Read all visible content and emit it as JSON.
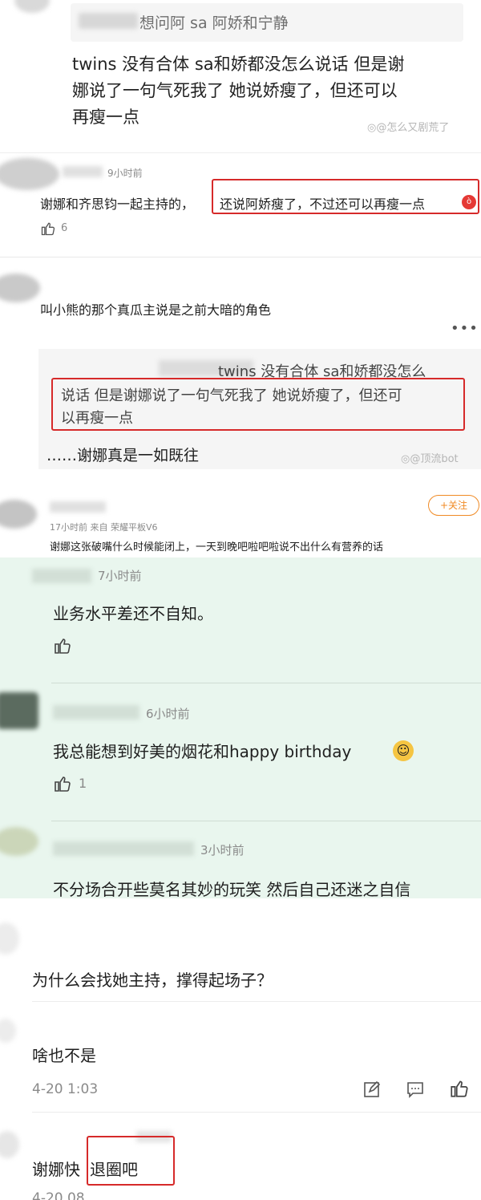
{
  "s1": {
    "quote": "想问阿 sa 阿娇和宁静",
    "body_lines": [
      "twins 没有合体 sa和娇都没怎么说话 但是谢",
      "娜说了一句气死我了 她说娇瘦了，但还可以",
      "再瘦一点"
    ],
    "watermark": "@怎么又剧荒了"
  },
  "s2": {
    "time": "9小时前",
    "text_a": "谢娜和齐思钧一起主持的，",
    "text_b": "还说阿娇瘦了，不过还可以再瘦一点",
    "likes": "6"
  },
  "s3": {
    "text": "叫小熊的那个真瓜主说是之前大暗的角色",
    "quote_lines": [
      "twins 没有合体 sa和娇都没怎么",
      "说话 但是谢娜说了一句气死我了 她说娇瘦了，但还可",
      "以再瘦一点"
    ],
    "reply": "……谢娜真是一如既往",
    "watermark": "@顶流bot"
  },
  "s4": {
    "follow": "+关注",
    "meta": "17小时前  来自 荣耀平板V6",
    "text": "谢娜这张破嘴什么时候能闭上，一天到晚吧啦吧啦说不出什么有营养的话"
  },
  "s5": {
    "c1": {
      "time": "7小时前",
      "text": "业务水平差还不自知。"
    },
    "c2": {
      "time": "6小时前",
      "text": "我总能想到好美的烟花和happy birthday",
      "likes": "1"
    },
    "c3": {
      "time": "3小时前",
      "text": "不分场合开些莫名其妙的玩笑 然后自己还迷之自信"
    }
  },
  "s6": {
    "q": "为什么会找她主持，撑得起场子？",
    "a": "啥也不是",
    "date": "4-20  1:03",
    "last_a": "谢娜快",
    "last_b": "退圈吧",
    "bottom_date": "4-20  08"
  },
  "colors": {
    "green_bg": "#e9f6ee",
    "red": "#d62a2a",
    "orange": "#f08a24"
  }
}
